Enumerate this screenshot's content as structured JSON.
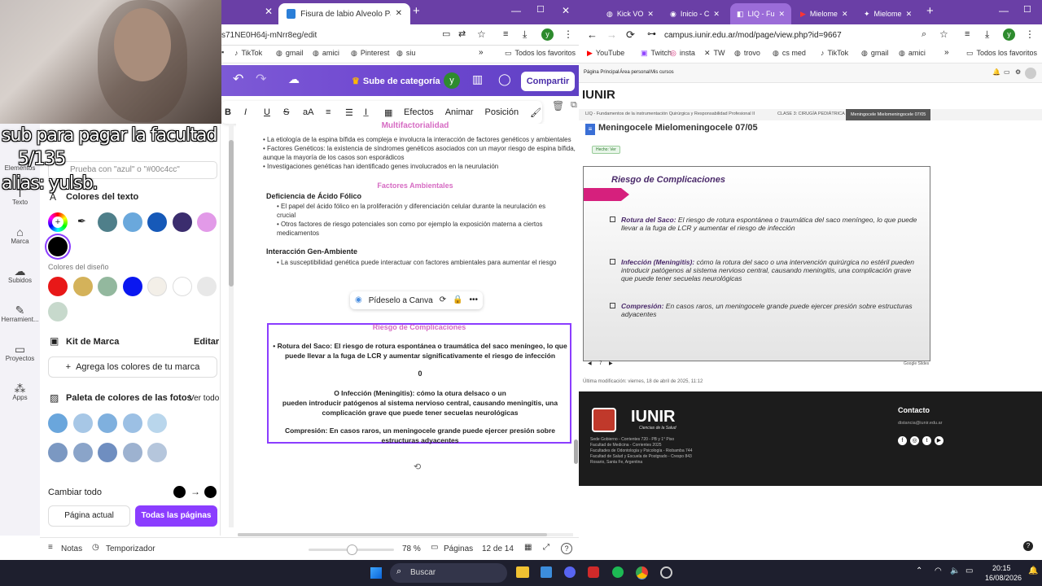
{
  "left_browser": {
    "tabs": [
      {
        "label": "Fisura de labio Alveolo Palatina",
        "active": true
      }
    ],
    "url": "s71NE0H64j-mNrr8eg/edit",
    "bookmarks": [
      "TikTok",
      "gmail",
      "amici",
      "Pinterest",
      "siu",
      "Todos los favoritos"
    ]
  },
  "canva": {
    "upgrade_label": "Sube de categoría",
    "avatar_letter": "y",
    "share_label": "Compartir",
    "toolbar": {
      "effects": "Efectos",
      "animate": "Animar",
      "position": "Posición"
    },
    "rail": [
      "Elementos",
      "Texto",
      "Marca",
      "Subidos",
      "Herramient...",
      "Proyectos",
      "Apps"
    ],
    "panel": {
      "search_placeholder": "Prueba con \"azul\" o \"#00c4cc\"",
      "text_colors_title": "Colores del texto",
      "design_colors_title": "Colores del diseño",
      "brand_kit_title": "Kit de Marca",
      "brand_edit": "Editar",
      "add_brand_colors": "Agrega los colores de tu marca",
      "photo_palette_title": "Paleta de colores de las fotos",
      "see_all": "Ver todo",
      "change_all": "Cambiar todo",
      "current_page": "Página actual",
      "all_pages": "Todas las páginas"
    },
    "text_colors": [
      "#4f7f8a",
      "#6aa8dc",
      "#1659b8",
      "#3b2d6e",
      "#e29ae8"
    ],
    "design_colors": [
      "#e81818",
      "#d4b25a",
      "#93b89e",
      "#0a17f0",
      "#f3efe8",
      "#ffffff",
      "#e8e8e8",
      "#c7d9cc"
    ],
    "photo_colors_row1": [
      "#6aa6dc",
      "#a7c7e6",
      "#7fb0de",
      "#9cc0e4",
      "#b9d6ec"
    ],
    "photo_colors_row2": [
      "#7b98c2",
      "#8aa4c9",
      "#6f8ec0",
      "#9db2d0",
      "#b5c6dc"
    ],
    "doc": {
      "heading_top": "Multifactorialidad",
      "bullets_top": [
        "La etiología de la espina bífida es compleja e involucra la interacción de factores genéticos y ambientales",
        "Factores Genéticos: la existencia de síndromes genéticos asociados con un mayor riesgo de espina bífida, aunque la mayoría de los casos son esporádicos",
        "Investigaciones genéticas han identificado genes involucrados en la neurulación"
      ],
      "heading_env": "Factores Ambientales",
      "folate_title": "Deficiencia de Ácido Fólico",
      "folate_bullets": [
        "El papel del ácido fólico en la proliferación y diferenciación celular durante la neurulación es crucial",
        "Otros factores de riesgo potenciales son como por ejemplo la exposición materna a ciertos medicamentos"
      ],
      "gene_env_title": "Interacción Gen-Ambiente",
      "gene_env_bullet": "La susceptibilidad genética puede interactuar con factores ambientales para aumentar el riesgo",
      "ask_canva": "Pídeselo a Canva",
      "risk_title": "Riesgo de Complicaciones",
      "risk_p1": "Rotura del Saco: El riesgo de rotura espontánea o traumática del saco meníngeo, lo que puede llevar a la fuga de LCR y aumentar significativamente el riesgo de infección",
      "risk_zero": "0",
      "risk_p2a": "O Infección (Meningitis): cómo la otura delsaco o un",
      "risk_p2b": "pueden introducir patógenos al sistema nervioso central, causando meningitis, una complicación grave que puede tener secuelas neurológicas",
      "risk_p3": "Compresión: En casos raros, un meningocele grande puede ejercer presión sobre estructuras adyacentes"
    },
    "bottom": {
      "notes": "Notas",
      "timer": "Temporizador",
      "zoom": "78 %",
      "pages_label": "Páginas",
      "page_counter": "12 de 14"
    }
  },
  "right_browser": {
    "tabs": [
      {
        "label": "Kick VO",
        "active": false
      },
      {
        "label": "Inicio - C",
        "active": false
      },
      {
        "label": "LIQ - Fu",
        "active": true
      },
      {
        "label": "Mielome",
        "active": false
      },
      {
        "label": "Mielome",
        "active": false
      }
    ],
    "url": "campus.iunir.edu.ar/mod/page/view.php?id=9667",
    "bookmarks": [
      "YouTube",
      "Twitch",
      "insta",
      "TW",
      "trovo",
      "cs med",
      "TikTok",
      "gmail",
      "amici",
      "Todos los favoritos"
    ],
    "site_nav": [
      "Página Principal",
      "Área personal",
      "Mis cursos"
    ],
    "brand": "IUNIR",
    "breadcrumb": [
      "LIQ - Fundamentos de la instrumentación Quirúrgica y Responsabilidad Profesional II",
      "CLASE 3: CIRUGÍA PEDIÁTRICA",
      "Meningocele Mielomeningocele 07/05"
    ],
    "page_title": "Meningocele Mielomeningocele 07/05",
    "done_badge": "Hecho: Ver",
    "slide": {
      "title": "Riesgo de Complicaciones",
      "items": [
        {
          "term": "Rotura del Saco:",
          "text": " El riesgo de rotura espontánea o traumática del saco meníngeo, lo que puede llevar a la fuga de LCR y aumentar el riesgo de infección"
        },
        {
          "term": "Infección (Meningitis):",
          "text": " cómo la rotura del saco o una intervención quirúrgica no estéril pueden introducir patógenos al sistema nervioso central, causando meningitis, una complicación grave que puede tener secuelas neurológicas"
        },
        {
          "term": "Compresión:",
          "text": " En casos raros, un meningocele grande puede ejercer presión sobre estructuras adyacentes"
        }
      ],
      "page_num": "7",
      "provider": "Google Slides"
    },
    "last_modified": "Última modificación: viernes, 18 de abril de 2025, 11:12",
    "footer": {
      "contact_title": "Contacto",
      "contact_email": "distancia@iunir.edu.ar",
      "logo_text": "IUNIR",
      "logo_sub": "Ciencias de la Salud",
      "lines": [
        "Sede Gobierno - Corrientes 720 - PB y 1° Piso",
        "Facultad de Medicina - Corrientes 2025",
        "Facultades de Odontología y Psicología - Riobamba 744",
        "Facultad de Salud y Escuela de Postgrado - Crespo 843",
        "Rosario, Santa Fe, Argentina"
      ]
    }
  },
  "overlay": {
    "line1": "sub para pagar la facultad",
    "line2": "5/135",
    "line3": "alias: yulsb."
  },
  "taskbar": {
    "search": "Buscar",
    "time": "20:15",
    "date": "16/08/2026"
  }
}
